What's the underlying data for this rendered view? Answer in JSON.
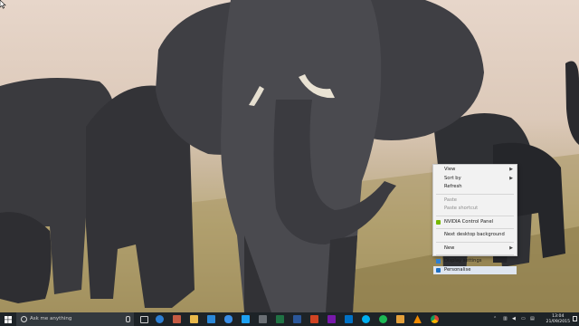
{
  "desktop": {
    "wallpaper": "elephant herd on savanna"
  },
  "context_menu": {
    "items": [
      {
        "label": "View",
        "submenu": true,
        "disabled": false
      },
      {
        "label": "Sort by",
        "submenu": true,
        "disabled": false
      },
      {
        "label": "Refresh",
        "submenu": false,
        "disabled": false
      },
      {
        "label": "Paste",
        "submenu": false,
        "disabled": true
      },
      {
        "label": "Paste shortcut",
        "submenu": false,
        "disabled": true
      },
      {
        "label": "NVIDIA Control Panel",
        "submenu": false,
        "disabled": false,
        "icon": "nvidia-icon"
      },
      {
        "label": "Next desktop background",
        "submenu": false,
        "disabled": false
      },
      {
        "label": "New",
        "submenu": true,
        "disabled": false
      },
      {
        "label": "Display settings",
        "submenu": false,
        "disabled": false,
        "icon": "display-icon"
      },
      {
        "label": "Personalise",
        "submenu": false,
        "disabled": false,
        "icon": "personalise-icon",
        "highlighted": true
      }
    ]
  },
  "taskbar": {
    "search_placeholder": "Ask me anything",
    "clock_time": "13:04",
    "clock_date": "21/09/2015",
    "pinned_icons": [
      "task-view-icon",
      "edge-icon",
      "store-icon",
      "explorer-icon",
      "mail-icon",
      "onedrive-icon",
      "twitter-icon",
      "calculator-icon",
      "excel-icon",
      "word-icon",
      "powerpoint-icon",
      "onenote-icon",
      "outlook-icon",
      "skype-icon",
      "spotify-icon",
      "paint-icon",
      "vlc-icon",
      "chrome-icon"
    ],
    "colors": {
      "bar": "#1d2327",
      "search": "#33393e",
      "accent": "#2d7fd3"
    }
  }
}
